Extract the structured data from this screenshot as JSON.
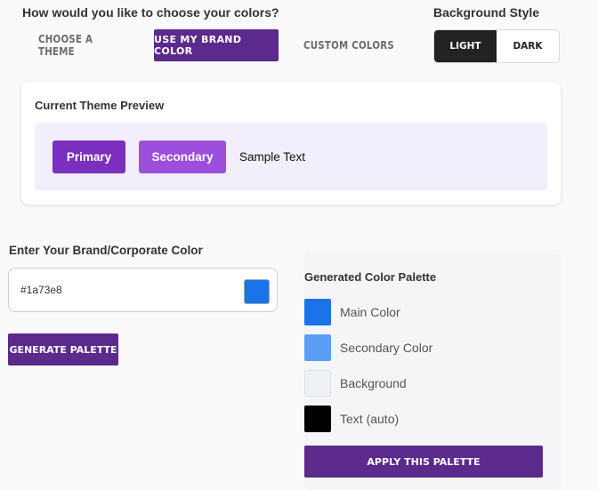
{
  "header": {
    "question": "How would you like to choose your colors?",
    "modes": [
      {
        "label": "Choose a Theme",
        "active": false
      },
      {
        "label": "Use My Brand Color",
        "active": true
      },
      {
        "label": "Custom Colors",
        "active": false
      }
    ]
  },
  "background_style": {
    "title": "Background Style",
    "options": [
      {
        "label": "Light",
        "active": true
      },
      {
        "label": "Dark",
        "active": false
      }
    ]
  },
  "preview": {
    "title": "Current Theme Preview",
    "primary_label": "Primary",
    "secondary_label": "Secondary",
    "sample_text": "Sample Text",
    "colors": {
      "primary": "#7b2fbe",
      "secondary": "#9c4fdc",
      "surface": "#f3eefb"
    }
  },
  "brand": {
    "label": "Enter Your Brand/Corporate Color",
    "value": "#1a73e8",
    "swatch_color": "#1a73e8",
    "generate_label": "Generate Palette"
  },
  "palette": {
    "title": "Generated Color Palette",
    "items": [
      {
        "label": "Main Color",
        "color": "#1a73e8"
      },
      {
        "label": "Secondary Color",
        "color": "#5c9ef5"
      },
      {
        "label": "Background",
        "color": "#eef2f6"
      },
      {
        "label": "Text (auto)",
        "color": "#000000"
      }
    ],
    "apply_label": "Apply This Palette"
  },
  "colors": {
    "accent": "#5b2a8c",
    "page_bg": "#fafafb"
  }
}
